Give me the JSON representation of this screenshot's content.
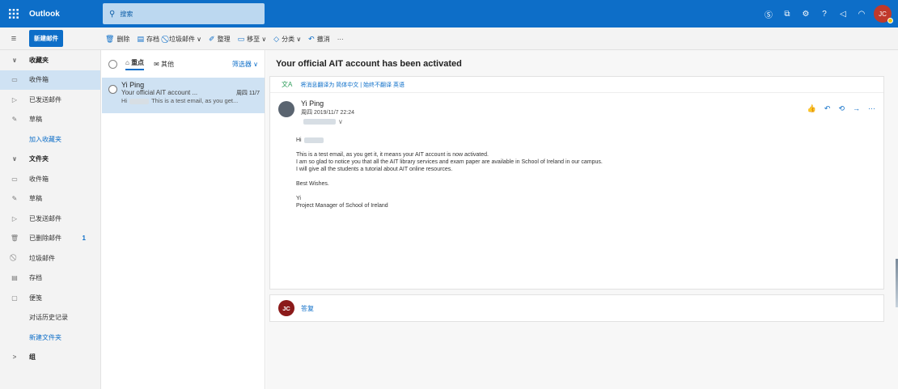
{
  "topbar": {
    "waffle_icon": "⋮⋮⋮",
    "brand": "Outlook",
    "search_placeholder": "搜索",
    "icons": [
      "skype-icon",
      "feedback-icon",
      "settings-icon",
      "help-icon",
      "megaphone-icon",
      "bell-icon"
    ],
    "avatar_initials": "JC",
    "color": "#0d6ec8"
  },
  "toolbar": {
    "new_mail": "新建邮件",
    "actions": [
      {
        "icon": "🗑",
        "label": "删除"
      },
      {
        "icon": "▤",
        "label": "存档"
      },
      {
        "icon": "⃠",
        "label": "垃圾邮件 ∨"
      },
      {
        "icon": "✐",
        "label": "整理"
      },
      {
        "icon": "▭",
        "label": "移至 ∨"
      },
      {
        "icon": "◇",
        "label": "分类 ∨"
      },
      {
        "icon": "↶",
        "label": "撤消"
      },
      {
        "icon": "",
        "label": "···"
      }
    ]
  },
  "sidebar": {
    "items": [
      {
        "label": "收藏夹",
        "icon": "∨",
        "type": "section"
      },
      {
        "label": "收件箱",
        "icon": "▭",
        "type": "selected"
      },
      {
        "label": "已发送邮件",
        "icon": "▷",
        "type": "item"
      },
      {
        "label": "草稿",
        "icon": "✎",
        "type": "item"
      },
      {
        "label": "加入收藏夹",
        "icon": "",
        "type": "link"
      },
      {
        "label": "文件夹",
        "icon": "∨",
        "type": "section"
      },
      {
        "label": "收件箱",
        "icon": "▭",
        "type": "item"
      },
      {
        "label": "草稿",
        "icon": "✎",
        "type": "item"
      },
      {
        "label": "已发送邮件",
        "icon": "▷",
        "type": "item"
      },
      {
        "label": "已删除邮件",
        "icon": "🗑",
        "type": "item",
        "count": "1"
      },
      {
        "label": "垃圾邮件",
        "icon": "⃠",
        "type": "item"
      },
      {
        "label": "存档",
        "icon": "▤",
        "type": "item"
      },
      {
        "label": "便笺",
        "icon": "▢",
        "type": "item"
      },
      {
        "label": "对话历史记录",
        "icon": "",
        "type": "link-plain"
      },
      {
        "label": "新建文件夹",
        "icon": "",
        "type": "link"
      },
      {
        "label": "组",
        "icon": ">",
        "type": "section"
      }
    ]
  },
  "message_list": {
    "tab_focused": "重点",
    "tab_other": "其他",
    "filter": "筛选器 ∨",
    "message": {
      "sender": "Yi Ping",
      "subject": "Your official AIT account ...",
      "date": "周四 11/7",
      "preview_start": "Hi",
      "preview_end": "This is a test email, as you get..."
    }
  },
  "reading": {
    "subject": "Your official AIT account has been activated",
    "translate_text": "将消息翻译为 简体中文 | 始终不翻译 英语",
    "sender": "Yi Ping",
    "date": "周四 2019/11/7 22:24",
    "greeting": "Hi",
    "body_lines": [
      "This is a test email, as you get it, it means your AIT account is now activated.",
      "I am so glad to notice you that all the AIT library services and exam paper are available in School of Ireland in our campus.",
      "I will give all the students a tutorial about AIT online resources."
    ],
    "closing": "Best Wishes.",
    "sign_name": "Yi",
    "sign_title": "Project Manager of School of Ireland",
    "reply_initials": "JC",
    "reply_label": "答复"
  }
}
